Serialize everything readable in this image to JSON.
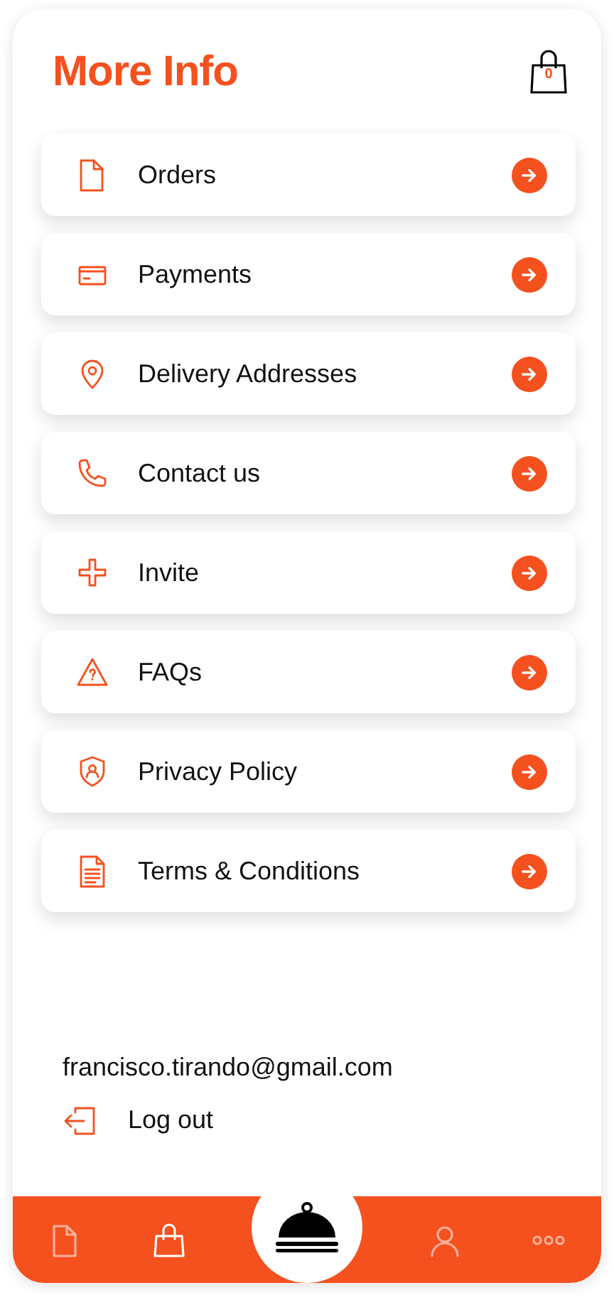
{
  "header": {
    "title": "More Info",
    "cart_count": "0"
  },
  "menu": [
    {
      "label": "Orders"
    },
    {
      "label": "Payments"
    },
    {
      "label": "Delivery Addresses"
    },
    {
      "label": "Contact us"
    },
    {
      "label": "Invite"
    },
    {
      "label": "FAQs"
    },
    {
      "label": "Privacy Policy"
    },
    {
      "label": "Terms & Conditions"
    }
  ],
  "account": {
    "email": "francisco.tirando@gmail.com",
    "logout": "Log out"
  },
  "bottom_nav": [
    {
      "selected": false
    },
    {
      "selected": true
    },
    {
      "selected": false
    },
    {
      "selected": false
    }
  ]
}
